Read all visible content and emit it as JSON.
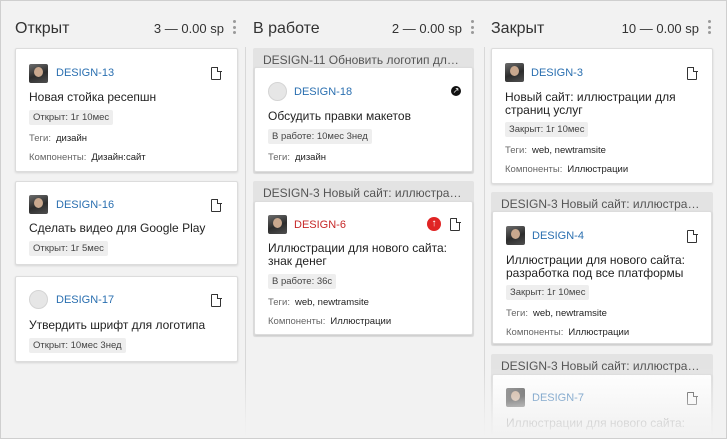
{
  "columns": [
    {
      "title": "Открыт",
      "count": "3 — 0.00 sp",
      "cards": [
        {
          "key": "DESIGN-13",
          "title": "Новая стойка ресепшн",
          "status": "Открыт: 1г 10мес",
          "tags_label": "Теги:",
          "tags": "дизайн",
          "components_label": "Компоненты:",
          "components": "Дизайн:сайт"
        },
        {
          "key": "DESIGN-16",
          "title": "Сделать видео для Google Play",
          "status": "Открыт: 1г 5мес"
        },
        {
          "key": "DESIGN-17",
          "title": "Утвердить шрифт для логотипа",
          "status": "Открыт: 10мес 3нед"
        }
      ]
    },
    {
      "title": "В работе",
      "count": "2 — 0.00 sp",
      "groups": [
        {
          "title": "DESIGN-11 Обновить логотип для ...",
          "card": {
            "key": "DESIGN-18",
            "title": "Обсудить правки макетов",
            "status": "В работе: 10мес 3нед",
            "tags_label": "Теги:",
            "tags": "дизайн"
          }
        },
        {
          "title": "DESIGN-3 Новый сайт: иллюстрац...",
          "card": {
            "key": "DESIGN-6",
            "title_line1": "Иллюстрации для нового сайта:",
            "title_line2": "знак денег",
            "status": "В работе: 36с",
            "tags_label": "Теги:",
            "tags": "web, newtramsite",
            "components_label": "Компоненты:",
            "components": "Иллюстрации"
          }
        }
      ]
    },
    {
      "title": "Закрыт",
      "count": "10 — 0.00 sp",
      "cards": [
        {
          "key": "DESIGN-3",
          "title_line1": "Новый сайт: иллюстрации для",
          "title_line2": "страниц услуг",
          "status": "Закрыт: 1г 10мес",
          "tags_label": "Теги:",
          "tags": "web, newtramsite",
          "components_label": "Компоненты:",
          "components": "Иллюстрации"
        }
      ],
      "groups": [
        {
          "title": "DESIGN-3 Новый сайт: иллюстрац...",
          "card": {
            "key": "DESIGN-4",
            "title_line1": "Иллюстрации для нового сайта:",
            "title_line2": "разработка под все платформы",
            "status": "Закрыт: 1г 10мес",
            "tags_label": "Теги:",
            "tags": "web, newtramsite",
            "components_label": "Компоненты:",
            "components": "Иллюстрации"
          }
        },
        {
          "title": "DESIGN-3 Новый сайт: иллюстрац...",
          "card": {
            "key": "DESIGN-7",
            "title_line1": "Иллюстрации для нового сайта:"
          }
        }
      ]
    }
  ],
  "icons": {
    "document": "document-icon",
    "priority_high": "arrow-up-icon",
    "priority_mark": "arrow-diagonal-icon",
    "menu": "kebab-menu-icon"
  },
  "colors": {
    "link": "#2a6fb0",
    "overdue": "#c62828",
    "priority_red": "#e02424"
  }
}
